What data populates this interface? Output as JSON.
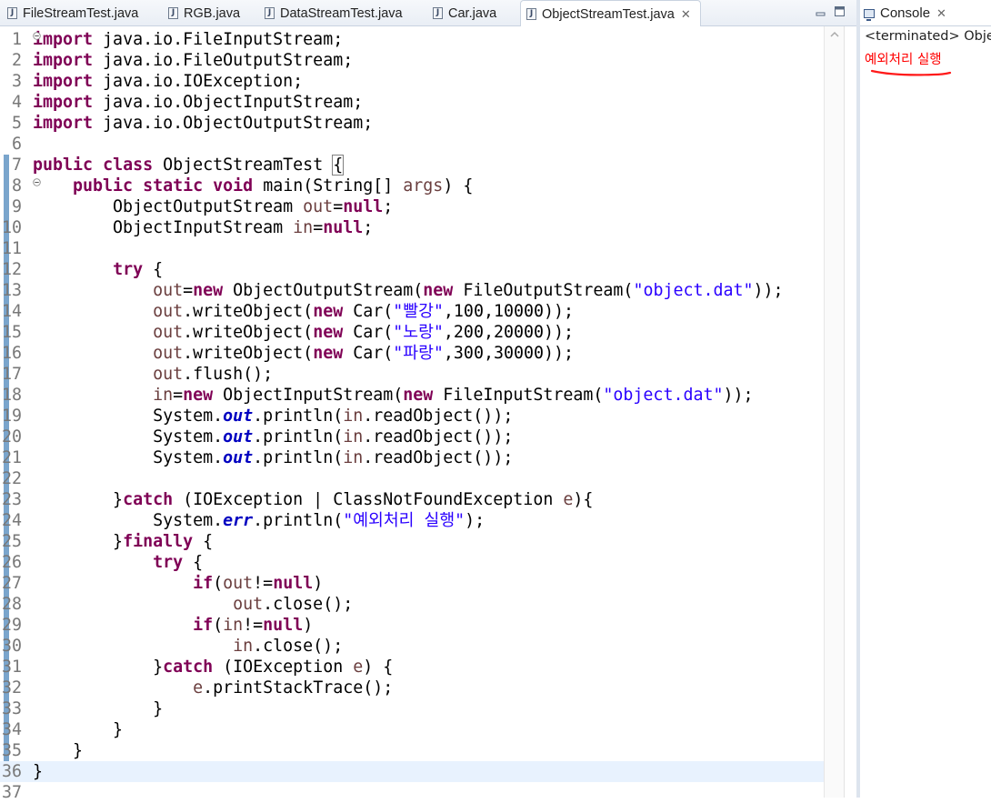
{
  "editor_tabs": [
    {
      "label": "FileStreamTest.java",
      "active": false
    },
    {
      "label": "RGB.java",
      "active": false
    },
    {
      "label": "DataStreamTest.java",
      "active": false
    },
    {
      "label": "Car.java",
      "active": false
    },
    {
      "label": "ObjectStreamTest.java",
      "active": true
    }
  ],
  "close_glyph": "✕",
  "console": {
    "tab_label": "Console",
    "status": "<terminated> Objec",
    "output_error": "예외처리 실행",
    "error_color": "#ff0000"
  },
  "editor": {
    "current_line": 36,
    "lines": [
      {
        "n": 1,
        "fold": "minus",
        "tokens": [
          [
            "kw",
            "import"
          ],
          [
            "txt",
            " java.io.FileInputStream;"
          ]
        ]
      },
      {
        "n": 2,
        "tokens": [
          [
            "kw",
            "import"
          ],
          [
            "txt",
            " java.io.FileOutputStream;"
          ]
        ]
      },
      {
        "n": 3,
        "tokens": [
          [
            "kw",
            "import"
          ],
          [
            "txt",
            " java.io.IOException;"
          ]
        ]
      },
      {
        "n": 4,
        "tokens": [
          [
            "kw",
            "import"
          ],
          [
            "txt",
            " java.io.ObjectInputStream;"
          ]
        ]
      },
      {
        "n": 5,
        "tokens": [
          [
            "kw",
            "import"
          ],
          [
            "txt",
            " java.io.ObjectOutputStream;"
          ]
        ]
      },
      {
        "n": 6,
        "tokens": []
      },
      {
        "n": 7,
        "tokens": [
          [
            "kw",
            "public"
          ],
          [
            "txt",
            " "
          ],
          [
            "kw",
            "class"
          ],
          [
            "txt",
            " ObjectStreamTest "
          ],
          [
            "box",
            "{"
          ]
        ]
      },
      {
        "n": 8,
        "fold": "minus",
        "tokens": [
          [
            "txt",
            "    "
          ],
          [
            "kw",
            "public"
          ],
          [
            "txt",
            " "
          ],
          [
            "kw",
            "static"
          ],
          [
            "txt",
            " "
          ],
          [
            "kw",
            "void"
          ],
          [
            "txt",
            " main(String[] "
          ],
          [
            "var",
            "args"
          ],
          [
            "txt",
            ") {"
          ]
        ]
      },
      {
        "n": 9,
        "tokens": [
          [
            "txt",
            "        ObjectOutputStream "
          ],
          [
            "var",
            "out"
          ],
          [
            "txt",
            "="
          ],
          [
            "kw",
            "null"
          ],
          [
            "txt",
            ";"
          ]
        ]
      },
      {
        "n": 10,
        "tokens": [
          [
            "txt",
            "        ObjectInputStream "
          ],
          [
            "var",
            "in"
          ],
          [
            "txt",
            "="
          ],
          [
            "kw",
            "null"
          ],
          [
            "txt",
            ";"
          ]
        ]
      },
      {
        "n": 11,
        "tokens": []
      },
      {
        "n": 12,
        "tokens": [
          [
            "txt",
            "        "
          ],
          [
            "kw",
            "try"
          ],
          [
            "txt",
            " {"
          ]
        ]
      },
      {
        "n": 13,
        "tokens": [
          [
            "txt",
            "            "
          ],
          [
            "var",
            "out"
          ],
          [
            "txt",
            "="
          ],
          [
            "kw",
            "new"
          ],
          [
            "txt",
            " ObjectOutputStream("
          ],
          [
            "kw",
            "new"
          ],
          [
            "txt",
            " FileOutputStream("
          ],
          [
            "str",
            "\"object.dat\""
          ],
          [
            "txt",
            "));"
          ]
        ]
      },
      {
        "n": 14,
        "tokens": [
          [
            "txt",
            "            "
          ],
          [
            "var",
            "out"
          ],
          [
            "txt",
            ".writeObject("
          ],
          [
            "kw",
            "new"
          ],
          [
            "txt",
            " Car("
          ],
          [
            "str",
            "\"빨강\""
          ],
          [
            "txt",
            ",100,10000));"
          ]
        ]
      },
      {
        "n": 15,
        "tokens": [
          [
            "txt",
            "            "
          ],
          [
            "var",
            "out"
          ],
          [
            "txt",
            ".writeObject("
          ],
          [
            "kw",
            "new"
          ],
          [
            "txt",
            " Car("
          ],
          [
            "str",
            "\"노랑\""
          ],
          [
            "txt",
            ",200,20000));"
          ]
        ]
      },
      {
        "n": 16,
        "tokens": [
          [
            "txt",
            "            "
          ],
          [
            "var",
            "out"
          ],
          [
            "txt",
            ".writeObject("
          ],
          [
            "kw",
            "new"
          ],
          [
            "txt",
            " Car("
          ],
          [
            "str",
            "\"파랑\""
          ],
          [
            "txt",
            ",300,30000));"
          ]
        ]
      },
      {
        "n": 17,
        "tokens": [
          [
            "txt",
            "            "
          ],
          [
            "var",
            "out"
          ],
          [
            "txt",
            ".flush();"
          ]
        ]
      },
      {
        "n": 18,
        "tokens": [
          [
            "txt",
            "            "
          ],
          [
            "var",
            "in"
          ],
          [
            "txt",
            "="
          ],
          [
            "kw",
            "new"
          ],
          [
            "txt",
            " ObjectInputStream("
          ],
          [
            "kw",
            "new"
          ],
          [
            "txt",
            " FileInputStream("
          ],
          [
            "str",
            "\"object.dat\""
          ],
          [
            "txt",
            "));"
          ]
        ]
      },
      {
        "n": 19,
        "tokens": [
          [
            "txt",
            "            System."
          ],
          [
            "fld",
            "out"
          ],
          [
            "txt",
            ".println("
          ],
          [
            "var",
            "in"
          ],
          [
            "txt",
            ".readObject());"
          ]
        ]
      },
      {
        "n": 20,
        "tokens": [
          [
            "txt",
            "            System."
          ],
          [
            "fld",
            "out"
          ],
          [
            "txt",
            ".println("
          ],
          [
            "var",
            "in"
          ],
          [
            "txt",
            ".readObject());"
          ]
        ]
      },
      {
        "n": 21,
        "tokens": [
          [
            "txt",
            "            System."
          ],
          [
            "fld",
            "out"
          ],
          [
            "txt",
            ".println("
          ],
          [
            "var",
            "in"
          ],
          [
            "txt",
            ".readObject());"
          ]
        ]
      },
      {
        "n": 22,
        "tokens": []
      },
      {
        "n": 23,
        "tokens": [
          [
            "txt",
            "        }"
          ],
          [
            "kw",
            "catch"
          ],
          [
            "txt",
            " (IOException | ClassNotFoundException "
          ],
          [
            "var",
            "e"
          ],
          [
            "txt",
            "){"
          ]
        ]
      },
      {
        "n": 24,
        "tokens": [
          [
            "txt",
            "            System."
          ],
          [
            "fld",
            "err"
          ],
          [
            "txt",
            ".println("
          ],
          [
            "str",
            "\"예외처리 실행\""
          ],
          [
            "txt",
            ");"
          ]
        ]
      },
      {
        "n": 25,
        "tokens": [
          [
            "txt",
            "        }"
          ],
          [
            "kw",
            "finally"
          ],
          [
            "txt",
            " {"
          ]
        ]
      },
      {
        "n": 26,
        "tokens": [
          [
            "txt",
            "            "
          ],
          [
            "kw",
            "try"
          ],
          [
            "txt",
            " {"
          ]
        ]
      },
      {
        "n": 27,
        "tokens": [
          [
            "txt",
            "                "
          ],
          [
            "kw",
            "if"
          ],
          [
            "txt",
            "("
          ],
          [
            "var",
            "out"
          ],
          [
            "txt",
            "!="
          ],
          [
            "kw",
            "null"
          ],
          [
            "txt",
            ")"
          ]
        ]
      },
      {
        "n": 28,
        "tokens": [
          [
            "txt",
            "                    "
          ],
          [
            "var",
            "out"
          ],
          [
            "txt",
            ".close();"
          ]
        ]
      },
      {
        "n": 29,
        "tokens": [
          [
            "txt",
            "                "
          ],
          [
            "kw",
            "if"
          ],
          [
            "txt",
            "("
          ],
          [
            "var",
            "in"
          ],
          [
            "txt",
            "!="
          ],
          [
            "kw",
            "null"
          ],
          [
            "txt",
            ")"
          ]
        ]
      },
      {
        "n": 30,
        "tokens": [
          [
            "txt",
            "                    "
          ],
          [
            "var",
            "in"
          ],
          [
            "txt",
            ".close();"
          ]
        ]
      },
      {
        "n": 31,
        "tokens": [
          [
            "txt",
            "            }"
          ],
          [
            "kw",
            "catch"
          ],
          [
            "txt",
            " (IOException "
          ],
          [
            "var",
            "e"
          ],
          [
            "txt",
            ") {"
          ]
        ]
      },
      {
        "n": 32,
        "tokens": [
          [
            "txt",
            "                "
          ],
          [
            "var",
            "e"
          ],
          [
            "txt",
            ".printStackTrace();"
          ]
        ]
      },
      {
        "n": 33,
        "tokens": [
          [
            "txt",
            "            }"
          ]
        ]
      },
      {
        "n": 34,
        "tokens": [
          [
            "txt",
            "        }"
          ]
        ]
      },
      {
        "n": 35,
        "tokens": [
          [
            "txt",
            "    }"
          ]
        ]
      },
      {
        "n": 36,
        "tokens": [
          [
            "txt",
            "}"
          ]
        ]
      },
      {
        "n": 37,
        "tokens": []
      }
    ]
  }
}
